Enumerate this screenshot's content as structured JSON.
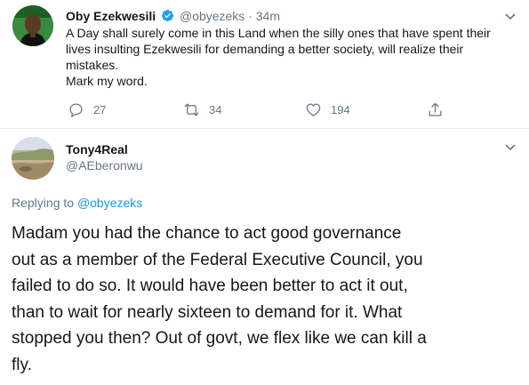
{
  "tweet": {
    "author_name": "Oby Ezekwesili",
    "author_handle": "@obyezeks",
    "separator": "·",
    "time": "34m",
    "text_lines": [
      "A Day shall surely come in this Land when the silly ones that have spent their",
      "lives  insulting Ezekwesili for demanding a better society, will realize their",
      "mistakes.",
      "Mark my word."
    ],
    "actions": {
      "replies": "27",
      "retweets": "34",
      "likes": "194"
    },
    "icons": [
      "verified-badge-icon",
      "chevron-down-icon",
      "reply-icon",
      "retweet-icon",
      "like-icon",
      "share-icon"
    ]
  },
  "reply": {
    "author_name": "Tony4Real",
    "author_handle": "@AEberonwu",
    "replying_to_label": "Replying to",
    "replying_to_handle": "@obyezeks",
    "text_lines": [
      "Madam you had the chance to act  good governance",
      "out as a member of the Federal Executive Council, you",
      "failed to do so. It would have been better to act it out,",
      "than to wait for nearly sixteen to demand for it.  What",
      "stopped you then? Out of govt, we flex like we can kill a",
      "fly."
    ]
  },
  "colors": {
    "text": "#14171a",
    "muted": "#657786",
    "link": "#1b95e0",
    "verified": "#1da1f2"
  }
}
